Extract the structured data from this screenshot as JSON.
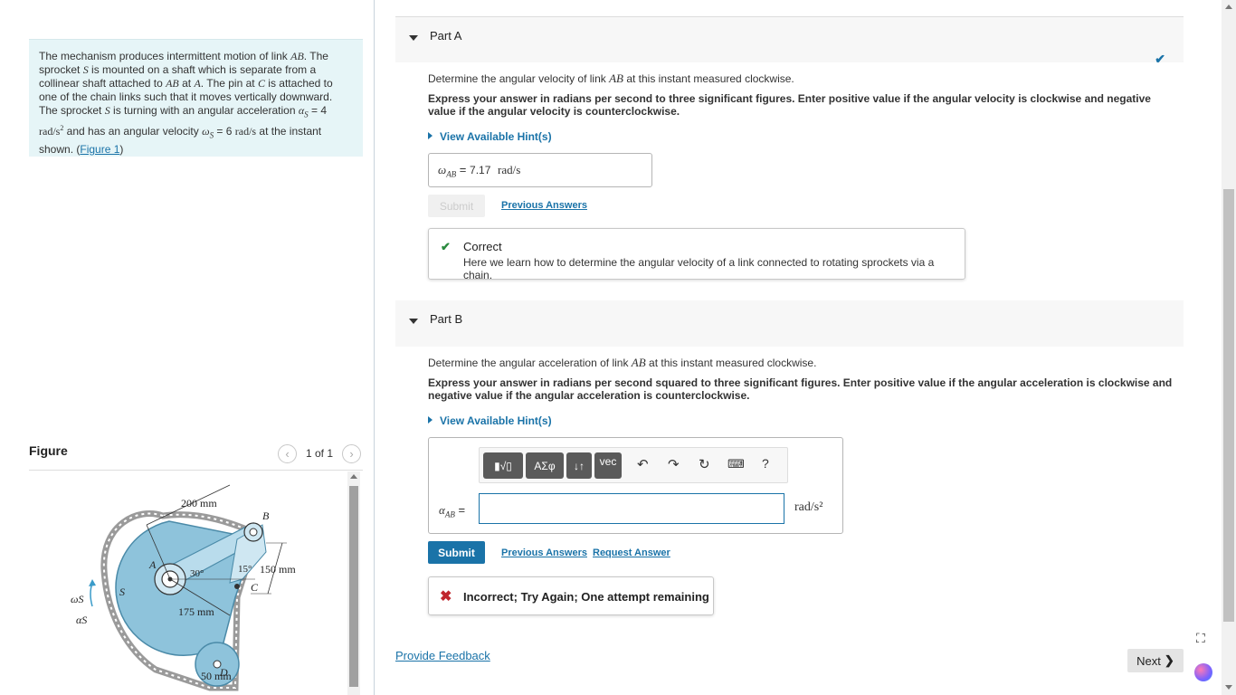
{
  "problem": {
    "text_html": "The mechanism produces intermittent motion of link <span class=\"math\">AB</span>. The sprocket <span class=\"math\">S</span> is mounted on a shaft which is separate from a collinear shaft attached to <span class=\"math\">AB</span> at <span class=\"math\">A</span>. The pin at <span class=\"math\">C</span> is attached to one of the chain links such that it moves vertically downward. The sprocket <span class=\"math\">S</span> is turning with an angular acceleration <span class=\"math\">α<sub style=\"font-size:9px\">S</sub></span> = 4 <span class=\"mathr\">rad/s<sup style=\"font-size:8px\">2</sup></span> and has an angular velocity <span class=\"math\">ω<sub style=\"font-size:9px\">S</sub></span> = 6 <span class=\"mathr\">rad/s</span> at the instant shown.",
    "figure_link": "Figure 1"
  },
  "figure": {
    "title": "Figure",
    "pager": "1 of 1",
    "labels": {
      "dim_200": "200 mm",
      "dim_150": "150 mm",
      "dim_175": "175 mm",
      "dim_50": "50 mm",
      "angle_30": "30°",
      "angle_15": "15°",
      "pt_A": "A",
      "pt_B": "B",
      "pt_C": "C",
      "pt_D": "D",
      "pt_S": "S",
      "omega_s": "ωS",
      "alpha_s": "αS"
    }
  },
  "partA": {
    "title": "Part A",
    "question": "Determine the angular velocity of link AB at this instant measured clockwise.",
    "instructions": "Express your answer in radians per second to three significant figures. Enter positive value if the angular velocity is clockwise and negative value if the angular velocity is counterclockwise.",
    "hint": "View Available Hint(s)",
    "answer_label": "ωAB =",
    "answer_value": "7.17",
    "answer_unit": "rad/s",
    "submit": "Submit",
    "previous_answers": "Previous Answers",
    "feedback_title": "Correct",
    "feedback_msg": "Here we learn how to determine the angular velocity of a link connected to rotating sprockets via a chain."
  },
  "partB": {
    "title": "Part B",
    "question": "Determine the angular acceleration of link AB at this instant measured clockwise.",
    "instructions": "Express your answer in radians per second squared to three significant figures. Enter positive value if the angular acceleration is clockwise and negative value if the angular acceleration is counterclockwise.",
    "hint": "View Available Hint(s)",
    "answer_label": "αAB =",
    "answer_unit": "rad/s²",
    "answer_value": "",
    "toolbar": {
      "templates": "▮√▯",
      "symbols": "ΑΣφ",
      "arrows": "↓↑",
      "vec": "vec",
      "help": "?"
    },
    "submit": "Submit",
    "previous_answers": "Previous Answers",
    "request_answer": "Request Answer",
    "feedback_msg": "Incorrect; Try Again; One attempt remaining"
  },
  "footer": {
    "provide_feedback": "Provide Feedback",
    "next": "Next"
  }
}
